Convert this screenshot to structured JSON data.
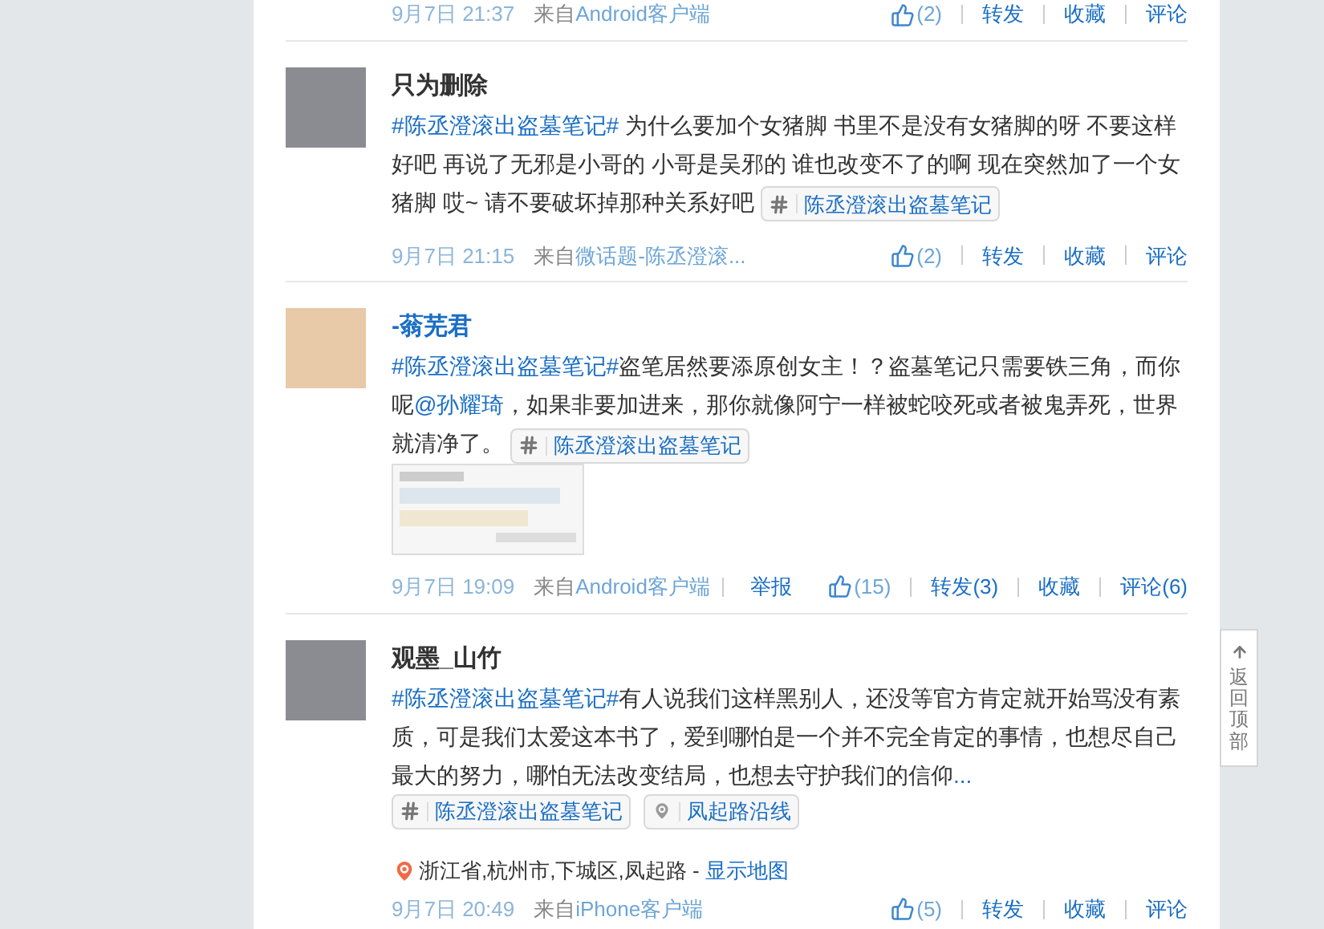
{
  "posts": [
    {
      "meta": {
        "time": "9月7日 21:37",
        "source_prefix": "来自",
        "source": "Android客户端",
        "actions": [
          {
            "kind": "like",
            "label": "(2)"
          },
          {
            "kind": "text",
            "label": "转发"
          },
          {
            "kind": "text",
            "label": "收藏"
          },
          {
            "kind": "text",
            "label": "评论"
          }
        ]
      }
    },
    {
      "user": "只为删除",
      "highlighted": false,
      "segments": [
        {
          "kind": "topic",
          "text": "#陈丞澄滚出盗墓笔记#"
        },
        {
          "kind": "text",
          "text": " 为什么要加个女猪脚 书里不是没有女猪脚的呀 不要这样好吧 再说了无邪是小哥的 小哥是吴邪的 谁也改变不了的啊 现在突然加了一个女猪脚 哎~ 请不要破坏掉那种关系好吧 "
        },
        {
          "kind": "tag",
          "text": "陈丞澄滚出盗墓笔记"
        }
      ],
      "meta": {
        "time": "9月7日 21:15",
        "source_prefix": "来自",
        "source": "微话题-陈丞澄滚...",
        "actions": [
          {
            "kind": "like",
            "label": "(2)"
          },
          {
            "kind": "text",
            "label": "转发"
          },
          {
            "kind": "text",
            "label": "收藏"
          },
          {
            "kind": "text",
            "label": "评论"
          }
        ]
      }
    },
    {
      "user": "-蓊芜君",
      "highlighted": true,
      "segments": [
        {
          "kind": "topic",
          "text": "#陈丞澄滚出盗墓笔记#"
        },
        {
          "kind": "text",
          "text": "盗笔居然要添原创女主！？盗墓笔记只需要铁三角，而你呢"
        },
        {
          "kind": "mention",
          "text": "@孙耀琦"
        },
        {
          "kind": "text",
          "text": "，如果非要加进来，那你就像阿宁一样被蛇咬死或者被鬼弄死，世界就清净了。 "
        },
        {
          "kind": "tag",
          "text": "陈丞澄滚出盗墓笔记"
        }
      ],
      "has_image": true,
      "meta": {
        "time": "9月7日 19:09",
        "source_prefix": "来自",
        "source": "Android客户端",
        "report": "举报",
        "actions": [
          {
            "kind": "like",
            "label": "(15)"
          },
          {
            "kind": "text",
            "label": "转发(3)"
          },
          {
            "kind": "text",
            "label": "收藏"
          },
          {
            "kind": "text",
            "label": "评论(6)"
          }
        ]
      }
    },
    {
      "user": "观墨_山竹",
      "highlighted": false,
      "segments": [
        {
          "kind": "topic",
          "text": "#陈丞澄滚出盗墓笔记#"
        },
        {
          "kind": "text",
          "text": "有人说我们这样黑别人，还没等官方肯定就开始骂没有素质，可是我们太爱这本书了，爱到哪怕是一个并不完全肯定的事情，也想尽自己最大的努力，哪怕无法改变结局，也想去守护我们的信仰"
        },
        {
          "kind": "more",
          "text": "..."
        }
      ],
      "tags": [
        {
          "kind": "topic",
          "text": "陈丞澄滚出盗墓笔记"
        },
        {
          "kind": "place",
          "text": "凤起路沿线"
        }
      ],
      "location": {
        "text": "浙江省,杭州市,下城区,凤起路 - ",
        "link": "显示地图"
      },
      "meta": {
        "time": "9月7日 20:49",
        "source_prefix": "来自",
        "source": "iPhone客户端",
        "actions": [
          {
            "kind": "like",
            "label": "(5)"
          },
          {
            "kind": "text",
            "label": "转发"
          },
          {
            "kind": "text",
            "label": "收藏"
          },
          {
            "kind": "text",
            "label": "评论"
          }
        ]
      }
    }
  ],
  "back_to_top": "返回顶部"
}
